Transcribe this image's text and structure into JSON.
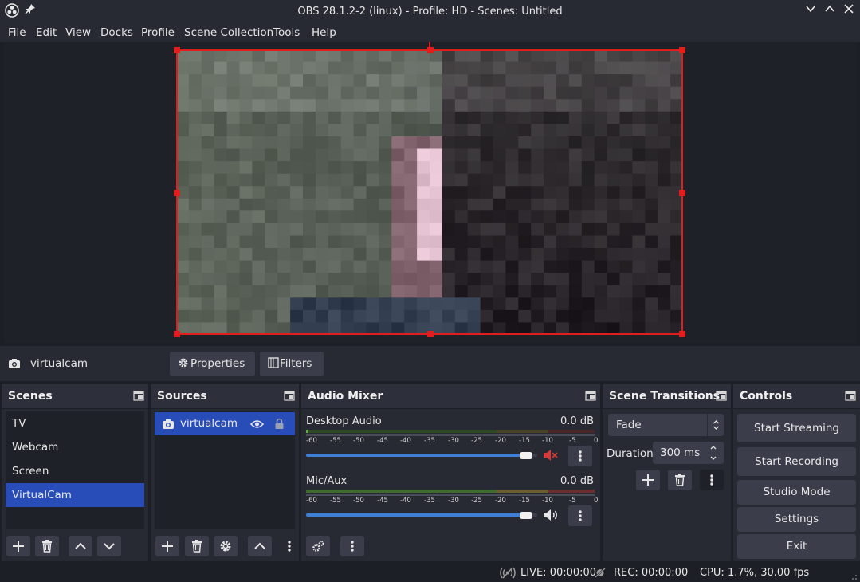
{
  "window": {
    "title": "OBS 28.1.2-2 (linux) - Profile: HD - Scenes: Untitled"
  },
  "menu": {
    "items": [
      {
        "u": "F",
        "rest": "ile"
      },
      {
        "u": "E",
        "rest": "dit"
      },
      {
        "u": "V",
        "rest": "iew"
      },
      {
        "u": "D",
        "rest": "ocks"
      },
      {
        "u": "P",
        "rest": "rofile"
      },
      {
        "u": "S",
        "rest": "cene Collection"
      },
      {
        "u": "T",
        "rest": "ools"
      },
      {
        "u": "H",
        "rest": "elp"
      }
    ]
  },
  "context": {
    "source_name": "virtualcam",
    "properties_label": "Properties",
    "filters_label": "Filters"
  },
  "scenes": {
    "title": "Scenes",
    "items": [
      "TV",
      "Webcam",
      "Screen",
      "VirtualCam"
    ],
    "selected_index": 3
  },
  "sources": {
    "title": "Sources",
    "items": [
      "virtualcam"
    ]
  },
  "audio_mixer": {
    "title": "Audio Mixer",
    "tick_labels": [
      "-60",
      "-55",
      "-50",
      "-45",
      "-40",
      "-35",
      "-30",
      "-25",
      "-20",
      "-15",
      "-10",
      "-5",
      "0"
    ],
    "channels": [
      {
        "name": "Desktop Audio",
        "db": "0.0 dB",
        "muted": true,
        "volume": 0.98
      },
      {
        "name": "Mic/Aux",
        "db": "0.0 dB",
        "muted": false,
        "volume": 0.98
      }
    ]
  },
  "transitions": {
    "title": "Scene Transitions",
    "selected": "Fade",
    "duration_label": "Duration",
    "duration_value": "300 ms"
  },
  "controls": {
    "title": "Controls",
    "start_streaming": "Start Streaming",
    "start_recording": "Start Recording",
    "studio_mode": "Studio Mode",
    "settings": "Settings",
    "exit": "Exit"
  },
  "status": {
    "live": "LIVE: 00:00:00",
    "rec": "REC: 00:00:00",
    "cpu": "CPU: 1.7%, 30.00 fps"
  },
  "colors": {
    "selection": "#284cb8",
    "bounding_box": "#e21d1d",
    "muted_icon": "#d63a3a"
  }
}
